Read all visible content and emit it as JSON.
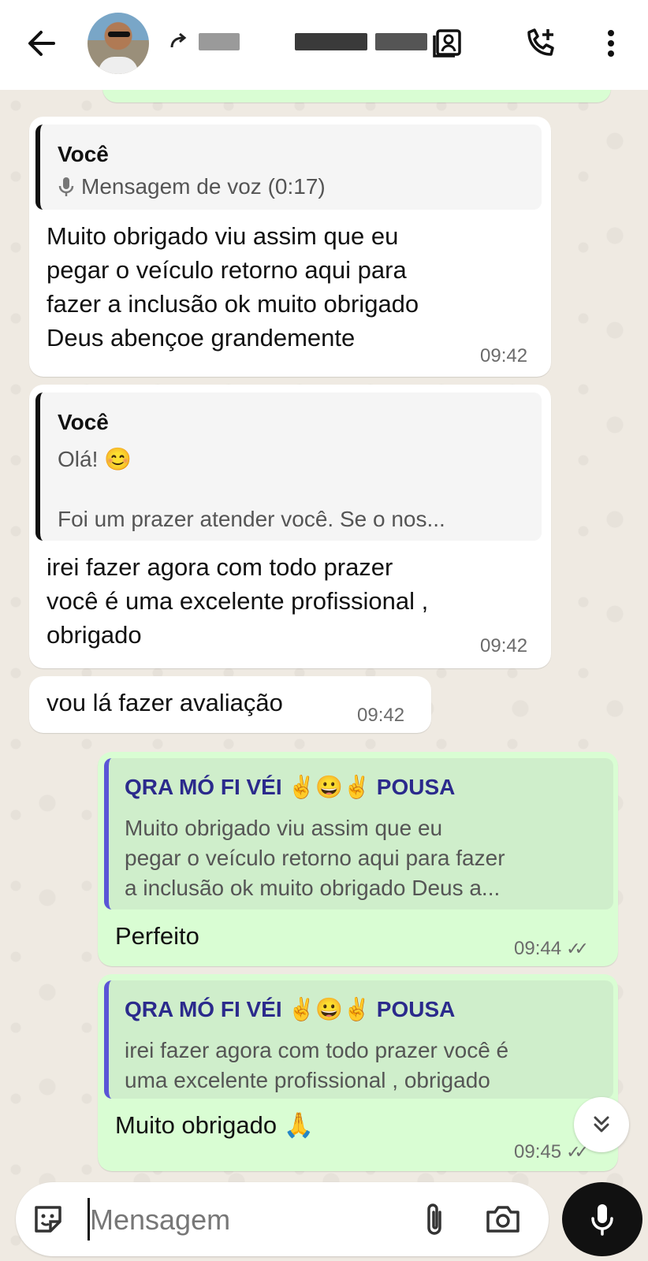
{
  "header": {
    "contact_name_redacted": "",
    "icons": [
      "back-arrow-icon",
      "avatar",
      "contact-card-icon",
      "add-call-icon",
      "more-vert-icon"
    ]
  },
  "messages": [
    {
      "direction": "in",
      "quote_author": "Você",
      "quote_text": "Mensagem de voz (0:17)",
      "quote_icon": "mic-icon",
      "line1": "Muito obrigado viu assim que eu",
      "line2": "pegar o veículo retorno aqui para",
      "line3": "fazer a inclusão ok muito obrigado",
      "line4": "Deus abençoe grandemente",
      "time": "09:42"
    },
    {
      "direction": "in",
      "quote_author": "Você",
      "quote_line1": "Olá! 😊",
      "quote_line2": "Foi um prazer atender você. Se o nos...",
      "line1": "irei fazer agora com todo prazer",
      "line2": "você é uma excelente profissional ,",
      "line3": "obrigado",
      "time": "09:42"
    },
    {
      "direction": "in",
      "text": "vou lá fazer avaliação",
      "time": "09:42"
    },
    {
      "direction": "out",
      "quote_author": "QRA MÓ FI VÉI ✌😀✌ POUSA",
      "quote_line1": "Muito obrigado viu assim que eu",
      "quote_line2": "pegar o veículo retorno aqui para fazer",
      "quote_line3": "a inclusão ok muito obrigado Deus a...",
      "text": "Perfeito",
      "time": "09:44",
      "ticks": "✓✓"
    },
    {
      "direction": "out",
      "quote_author": "QRA MÓ FI VÉI ✌😀✌ POUSA",
      "quote_line1": "irei fazer agora com todo prazer você é",
      "quote_line2": "uma excelente profissional , obrigado",
      "text": "Muito obrigado 🙏",
      "time": "09:45",
      "ticks": "✓✓"
    }
  ],
  "composer": {
    "placeholder": "Mensagem",
    "icons": [
      "sticker-icon",
      "attach-icon",
      "camera-icon",
      "mic-icon"
    ]
  },
  "colors": {
    "incoming_bubble": "#ffffff",
    "outgoing_bubble": "#d9fdd3",
    "quote_bar_out": "#5b55d6",
    "quote_author_out": "#2b2a8c",
    "wallpaper": "#efeae2"
  }
}
